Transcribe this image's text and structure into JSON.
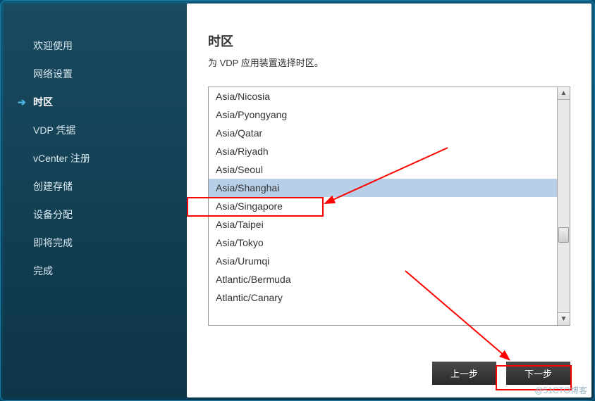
{
  "sidebar": {
    "items": [
      {
        "label": "欢迎使用"
      },
      {
        "label": "网络设置"
      },
      {
        "label": "时区"
      },
      {
        "label": "VDP 凭据"
      },
      {
        "label": "vCenter 注册"
      },
      {
        "label": "创建存储"
      },
      {
        "label": "设备分配"
      },
      {
        "label": "即将完成"
      },
      {
        "label": "完成"
      }
    ],
    "active_index": 2
  },
  "main": {
    "title": "时区",
    "subtitle": "为 VDP 应用装置选择时区。",
    "timezones": [
      "Asia/Nicosia",
      "Asia/Pyongyang",
      "Asia/Qatar",
      "Asia/Riyadh",
      "Asia/Seoul",
      "Asia/Shanghai",
      "Asia/Singapore",
      "Asia/Taipei",
      "Asia/Tokyo",
      "Asia/Urumqi",
      "Atlantic/Bermuda",
      "Atlantic/Canary"
    ],
    "selected_index": 5
  },
  "buttons": {
    "prev": "上一步",
    "next": "下一步"
  },
  "watermark": "@51CTO博客"
}
